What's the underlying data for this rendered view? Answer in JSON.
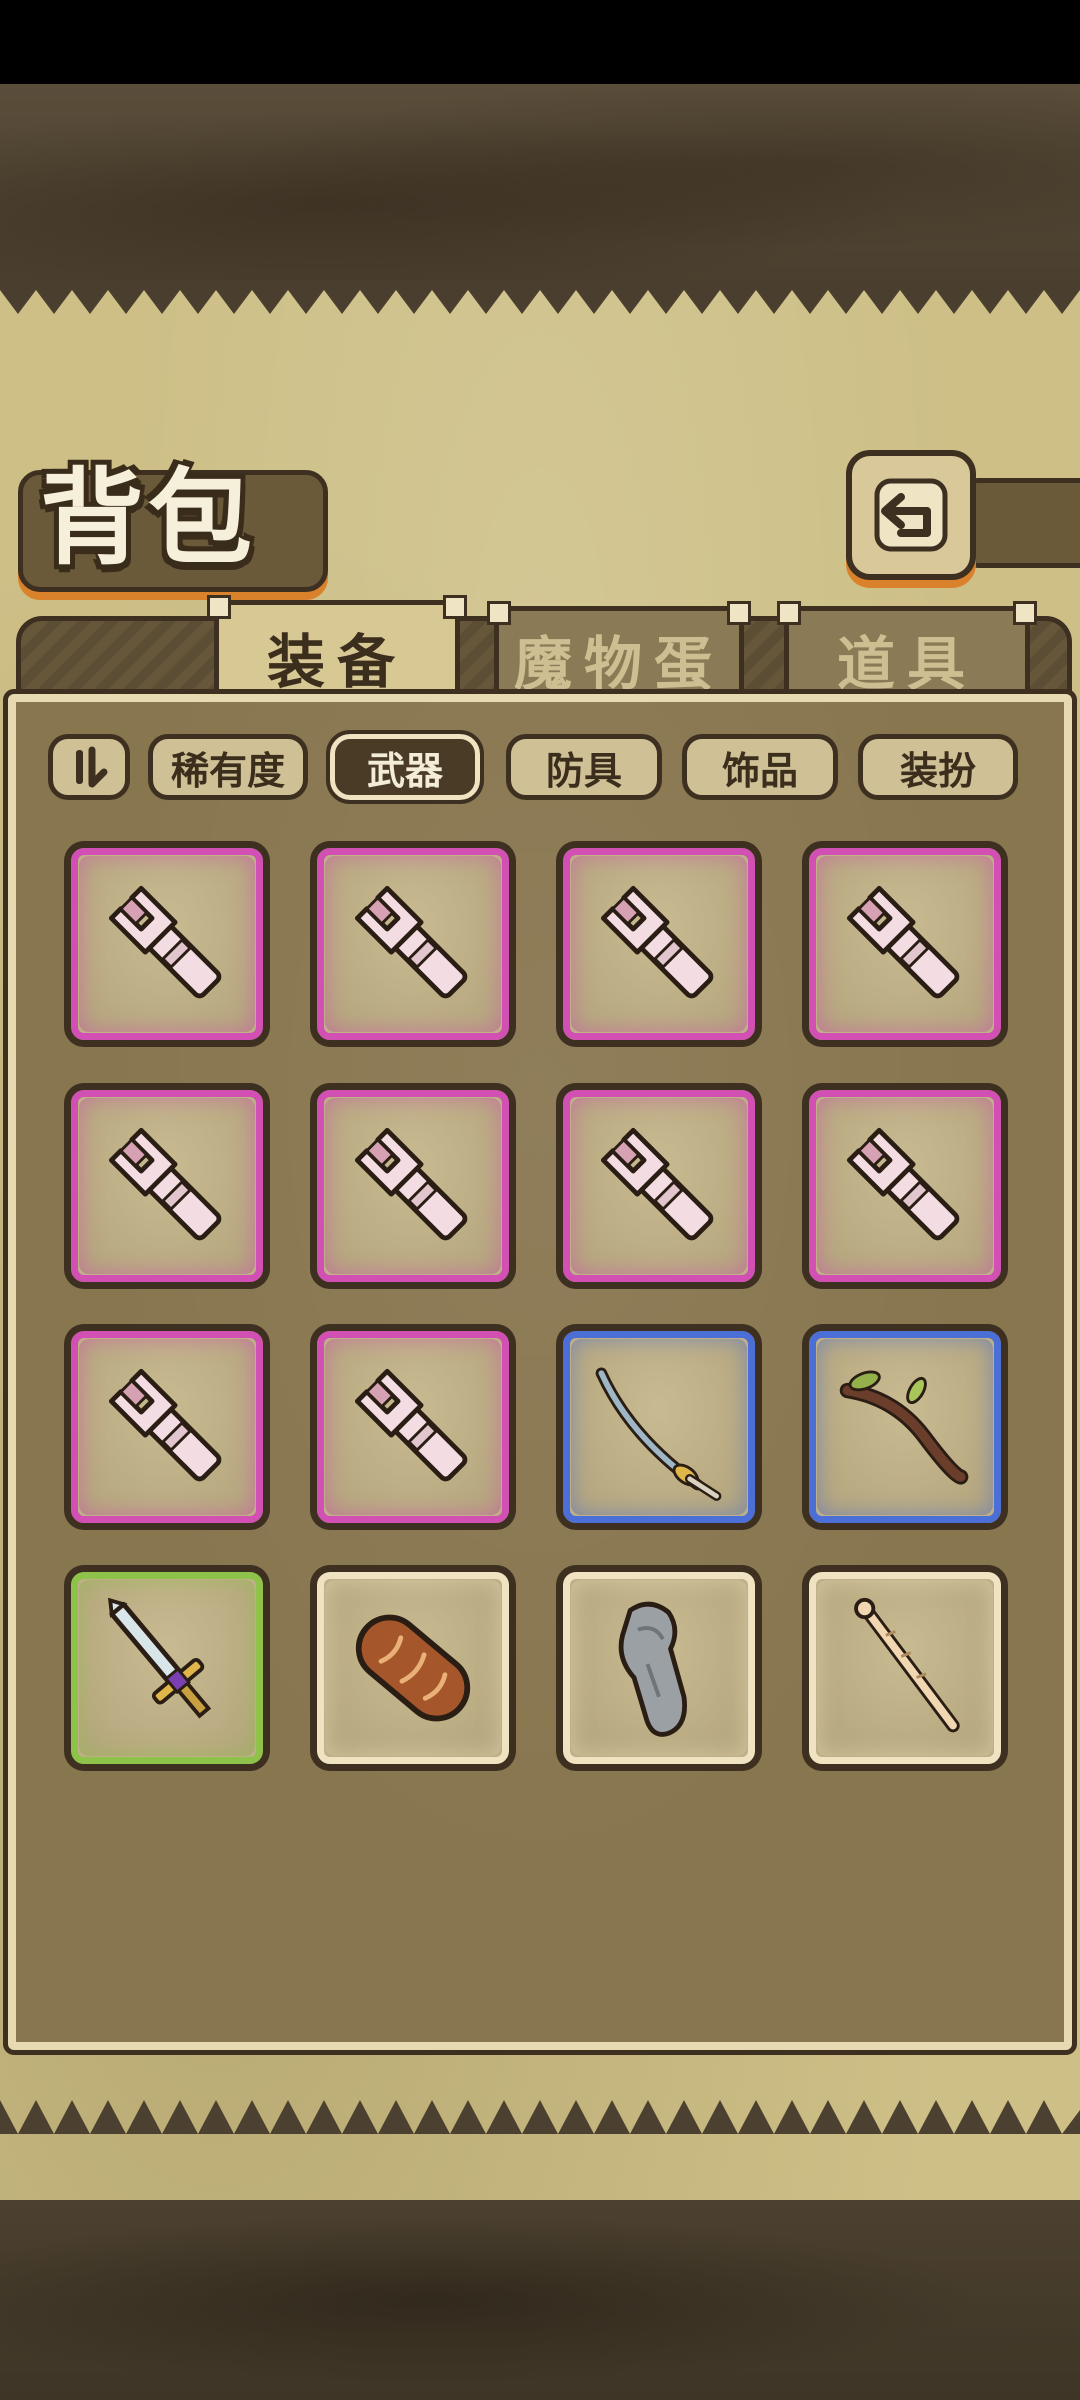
{
  "header": {
    "title": "背包"
  },
  "tabs": [
    {
      "label": "装备",
      "active": true
    },
    {
      "label": "魔物蛋",
      "active": false
    },
    {
      "label": "道具",
      "active": false
    }
  ],
  "filters": {
    "sort_icon": "sort-toggle-icon",
    "items": [
      {
        "label": "稀有度",
        "selected": false
      },
      {
        "label": "武器",
        "selected": true
      },
      {
        "label": "防具",
        "selected": false
      },
      {
        "label": "饰品",
        "selected": false
      },
      {
        "label": "装扮",
        "selected": false
      }
    ]
  },
  "rarity_colors": {
    "epic": "#d24fb4",
    "rare": "#4b6fd6",
    "uncommon": "#8fc24a",
    "common": "#efe3c2"
  },
  "items": [
    {
      "icon": "wrench-icon",
      "rarity": "epic"
    },
    {
      "icon": "wrench-icon",
      "rarity": "epic"
    },
    {
      "icon": "wrench-icon",
      "rarity": "epic"
    },
    {
      "icon": "wrench-icon",
      "rarity": "epic"
    },
    {
      "icon": "wrench-icon",
      "rarity": "epic"
    },
    {
      "icon": "wrench-icon",
      "rarity": "epic"
    },
    {
      "icon": "wrench-icon",
      "rarity": "epic"
    },
    {
      "icon": "wrench-icon",
      "rarity": "epic"
    },
    {
      "icon": "wrench-icon",
      "rarity": "epic"
    },
    {
      "icon": "wrench-icon",
      "rarity": "epic"
    },
    {
      "icon": "katana-icon",
      "rarity": "rare"
    },
    {
      "icon": "branch-staff-icon",
      "rarity": "rare"
    },
    {
      "icon": "broadsword-icon",
      "rarity": "uncommon"
    },
    {
      "icon": "bread-loaf-icon",
      "rarity": "common"
    },
    {
      "icon": "stone-statue-icon",
      "rarity": "common"
    },
    {
      "icon": "carved-wand-icon",
      "rarity": "common"
    }
  ]
}
